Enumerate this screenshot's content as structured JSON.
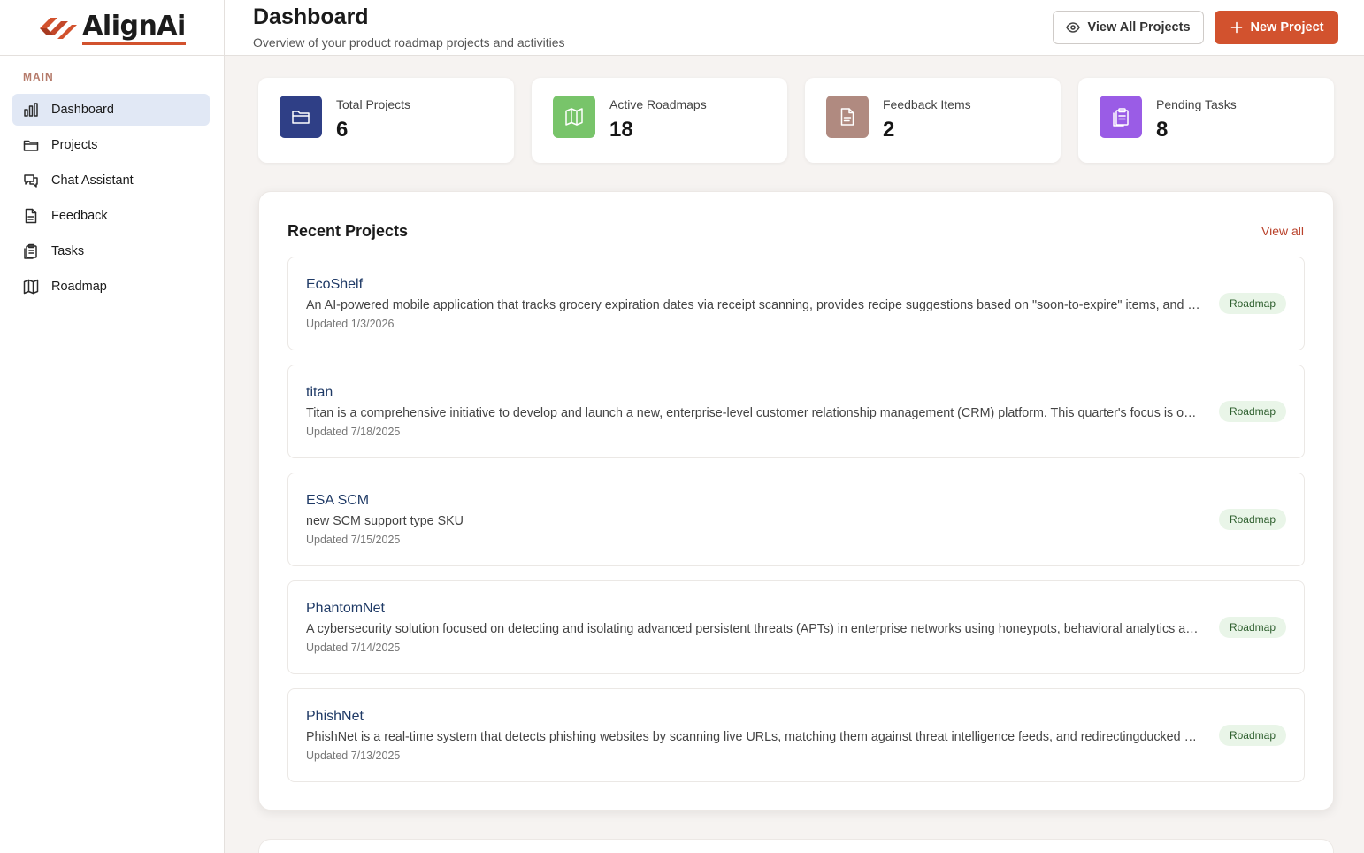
{
  "brand": {
    "name": "AlignAi",
    "accent": "#d2522e"
  },
  "sidebar": {
    "section_label": "MAIN",
    "items": [
      {
        "label": "Dashboard",
        "icon": "bar-chart-icon",
        "active": true
      },
      {
        "label": "Projects",
        "icon": "folder-icon"
      },
      {
        "label": "Chat Assistant",
        "icon": "chat-icon"
      },
      {
        "label": "Feedback",
        "icon": "document-icon"
      },
      {
        "label": "Tasks",
        "icon": "clipboard-icon"
      },
      {
        "label": "Roadmap",
        "icon": "map-icon"
      }
    ]
  },
  "header": {
    "title": "Dashboard",
    "subtitle": "Overview of your product roadmap projects and activities",
    "view_all_label": "View All Projects",
    "new_project_label": "New Project"
  },
  "stats": [
    {
      "label": "Total Projects",
      "value": "6",
      "color": "#2f3f86",
      "icon": "folder-icon"
    },
    {
      "label": "Active Roadmaps",
      "value": "18",
      "color": "#78c46a",
      "icon": "map-icon"
    },
    {
      "label": "Feedback Items",
      "value": "2",
      "color": "#b08a80",
      "icon": "document-icon"
    },
    {
      "label": "Pending Tasks",
      "value": "8",
      "color": "#9a5ce6",
      "icon": "clipboard-icon"
    }
  ],
  "recent": {
    "title": "Recent Projects",
    "view_all": "View all",
    "projects": [
      {
        "name": "EcoShelf",
        "description": "An AI-powered mobile application that tracks grocery expiration dates via receipt scanning, provides recipe suggestions based on \"soon-to-expire\" items, and helps reduce household food waste.",
        "updated": "Updated 1/3/2026",
        "badge": "Roadmap"
      },
      {
        "name": "titan",
        "description": "Titan is a comprehensive initiative to develop and launch a new, enterprise-level customer relationship management (CRM) platform. This quarter's focus is on core features.",
        "updated": "Updated 7/18/2025",
        "badge": "Roadmap"
      },
      {
        "name": "ESA SCM",
        "description": "new SCM support type SKU",
        "updated": "Updated 7/15/2025",
        "badge": "Roadmap"
      },
      {
        "name": "PhantomNet",
        "description": "A cybersecurity solution focused on detecting and isolating advanced persistent threats (APTs) in enterprise networks using honeypots, behavioral analytics and deception technology.",
        "updated": "Updated 7/14/2025",
        "badge": "Roadmap"
      },
      {
        "name": "PhishNet",
        "description": "PhishNet is a real-time system that detects phishing websites by scanning live URLs, matching them against threat intelligence feeds, and redirectingducked users to safety.",
        "updated": "Updated 7/13/2025",
        "badge": "Roadmap"
      }
    ]
  }
}
